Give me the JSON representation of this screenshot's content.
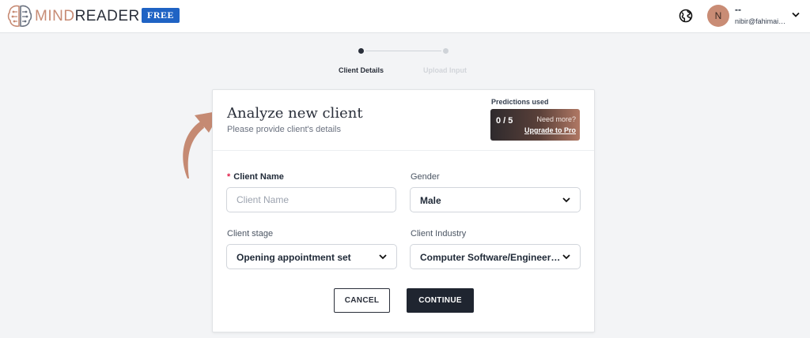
{
  "header": {
    "logo_icon": "brain-circuit-icon",
    "brand_mind": "MIND",
    "brand_reader": "READER",
    "plan_badge": "FREE",
    "globe_icon": "globe-icon",
    "user": {
      "avatar_initial": "N",
      "name": "--",
      "email": "nibir@fahimai.com"
    }
  },
  "stepper": {
    "steps": [
      {
        "label": "Client Details",
        "active": true
      },
      {
        "label": "Upload Input",
        "active": false
      }
    ]
  },
  "card": {
    "title": "Analyze new client",
    "subtitle": "Please provide client's details",
    "predictions": {
      "label": "Predictions used",
      "count": "0 / 5",
      "need_more": "Need more?",
      "upgrade": "Upgrade to Pro"
    },
    "fields": {
      "client_name": {
        "required_mark": "*",
        "label": "Client Name",
        "placeholder": "Client Name",
        "value": ""
      },
      "gender": {
        "label": "Gender",
        "value": "Male"
      },
      "client_stage": {
        "label": "Client stage",
        "value": "Opening appointment set"
      },
      "client_industry": {
        "label": "Client Industry",
        "value": "Computer Software/Engineering"
      }
    },
    "buttons": {
      "cancel": "CANCEL",
      "continue": "CONTINUE"
    }
  },
  "colors": {
    "accent": "#c98c75",
    "badge": "#1f63c4",
    "primary_button": "#1f2530",
    "required": "#e11d48"
  }
}
